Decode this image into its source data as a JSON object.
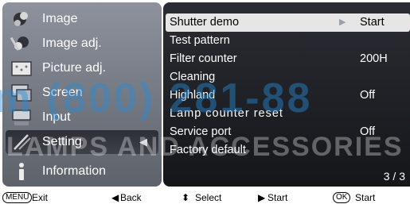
{
  "left_menu": {
    "items": [
      {
        "label": "Image",
        "icon": "image-icon"
      },
      {
        "label": "Image adj.",
        "icon": "image-adj-icon"
      },
      {
        "label": "Picture adj.",
        "icon": "picture-adj-icon"
      },
      {
        "label": "Screen",
        "icon": "screen-icon"
      },
      {
        "label": "Input",
        "icon": "input-icon"
      },
      {
        "label": "Setting",
        "icon": "setting-icon",
        "active": true
      },
      {
        "label": "Information",
        "icon": "information-icon"
      }
    ]
  },
  "right_menu": {
    "rows": [
      {
        "label": "Shutter demo",
        "value": "Start",
        "selected": true
      },
      {
        "label": "Test pattern",
        "value": ""
      },
      {
        "label": "Filter counter",
        "value": "200H"
      },
      {
        "label": "Cleaning",
        "value": ""
      },
      {
        "label": "Highland",
        "value": "Off"
      },
      {
        "label": "Lamp counter reset",
        "value": ""
      },
      {
        "label": "Service port",
        "value": "Off"
      },
      {
        "label": "Factory default",
        "value": ""
      }
    ],
    "page_indicator": "3 / 3"
  },
  "bottom_bar": {
    "menu_key": "MENU",
    "exit_label": "Exit",
    "back_label": "Back",
    "select_label": "Select",
    "start_label": "Start",
    "ok_key": "OK",
    "ok_start_label": "Start"
  },
  "watermark": {
    "phone": "m (800) 281-88",
    "company": "LAMPS AND ACCESSORIES"
  },
  "colors": {
    "left_panel": "#7a7f88",
    "right_panel": "#1e2126",
    "selected_row": "#e6e6e6",
    "watermark_blue": "#288cd7"
  }
}
